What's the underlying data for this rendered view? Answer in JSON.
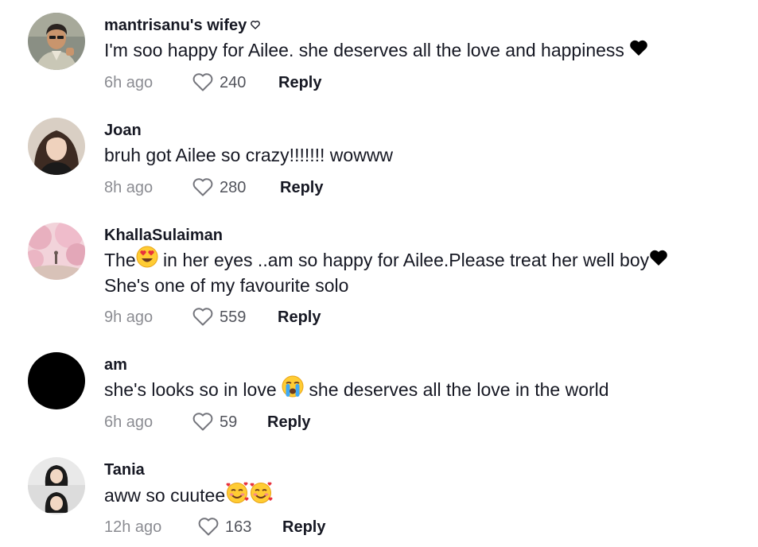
{
  "comments": [
    {
      "username": "mantrisanu's wifey",
      "text": "I'm soo happy for Ailee. she deserves all the love and happiness",
      "time": "6h ago",
      "likes": "240",
      "reply": "Reply"
    },
    {
      "username": "Joan",
      "text": "bruh got Ailee so crazy!!!!!!! wowww",
      "time": "8h ago",
      "likes": "280",
      "reply": "Reply"
    },
    {
      "username": "KhallaSulaiman",
      "text_a": "The",
      "text_b": " in her eyes ..am so happy for Ailee.Please treat her well boy",
      "text_line2": "She's one of my favourite solo",
      "time": "9h ago",
      "likes": "559",
      "reply": "Reply"
    },
    {
      "username": "am",
      "text_a": "she's looks so in love ",
      "text_b": " she deserves all the love in the world",
      "time": "6h ago",
      "likes": "59",
      "reply": "Reply"
    },
    {
      "username": "Tania",
      "text": "aww so cuutee",
      "time": "12h ago",
      "likes": "163",
      "reply": "Reply"
    }
  ],
  "colors": {
    "text": "#161823",
    "muted": "rgba(22,24,35,0.5)",
    "background": "#ffffff"
  },
  "icons": {
    "like": "heart-outline-icon",
    "badge": "small-heart-outline-icon",
    "emoji_black_heart": "black-heart-emoji",
    "emoji_heart_eyes": "smiling-face-with-heart-eyes-emoji",
    "emoji_crying": "loudly-crying-face-emoji",
    "emoji_hearts_face": "smiling-face-with-hearts-emoji"
  }
}
